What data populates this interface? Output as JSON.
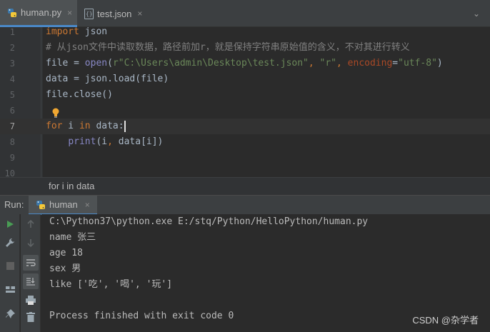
{
  "tabs": [
    {
      "label": "human.py",
      "close": "×"
    },
    {
      "label": "test.json",
      "close": "×"
    }
  ],
  "tabbar_more": "⌄",
  "editor": {
    "lines": [
      {
        "num": "1",
        "tokens": [
          {
            "t": "import",
            "c": "kw"
          },
          {
            "t": " json",
            "c": ""
          }
        ]
      },
      {
        "num": "2",
        "tokens": [
          {
            "t": "# 从json文件中读取数据，路径前加r，就是保持字符串原始值的含义，不对其进行转义",
            "c": "cmt"
          }
        ]
      },
      {
        "num": "3",
        "tokens": [
          {
            "t": "file = ",
            "c": ""
          },
          {
            "t": "open",
            "c": "fn"
          },
          {
            "t": "(",
            "c": ""
          },
          {
            "t": "r\"C:\\Users\\admin\\Desktop\\test.json\"",
            "c": "str"
          },
          {
            "t": ", ",
            "c": "kw"
          },
          {
            "t": "\"r\"",
            "c": "str"
          },
          {
            "t": ", ",
            "c": "kw"
          },
          {
            "t": "encoding",
            "c": "param"
          },
          {
            "t": "=",
            "c": ""
          },
          {
            "t": "\"utf-8\"",
            "c": "str"
          },
          {
            "t": ")",
            "c": ""
          }
        ]
      },
      {
        "num": "4",
        "tokens": [
          {
            "t": "data = json.load(file)",
            "c": ""
          }
        ]
      },
      {
        "num": "5",
        "tokens": [
          {
            "t": "file.close()",
            "c": ""
          }
        ]
      },
      {
        "num": "6",
        "tokens": []
      },
      {
        "num": "7",
        "tokens": [
          {
            "t": "for",
            "c": "kw"
          },
          {
            "t": " i ",
            "c": ""
          },
          {
            "t": "in",
            "c": "kw"
          },
          {
            "t": " data:",
            "c": ""
          }
        ],
        "current": true
      },
      {
        "num": "8",
        "tokens": [
          {
            "t": "    ",
            "c": ""
          },
          {
            "t": "print",
            "c": "fn"
          },
          {
            "t": "(i",
            "c": ""
          },
          {
            "t": ", ",
            "c": "kw"
          },
          {
            "t": "data[i])",
            "c": ""
          }
        ]
      },
      {
        "num": "9",
        "tokens": []
      },
      {
        "num": "10",
        "tokens": []
      }
    ]
  },
  "breadcrumb": "for i in data",
  "run": {
    "label": "Run:",
    "tab_label": "human",
    "tab_close": "×"
  },
  "console": {
    "lines": [
      "C:\\Python37\\python.exe E:/stq/Python/HelloPython/human.py",
      "name 张三",
      "age 18",
      "sex 男",
      "like ['吃', '喝', '玩']",
      "",
      "Process finished with exit code 0"
    ]
  },
  "watermark": "CSDN @杂学者",
  "colors": {
    "keyword": "#cc7832",
    "string": "#6a8759",
    "comment": "#808080",
    "builtin": "#8888c6",
    "param": "#aa4926",
    "accent": "#4a88c7",
    "run_green": "#499c54"
  }
}
